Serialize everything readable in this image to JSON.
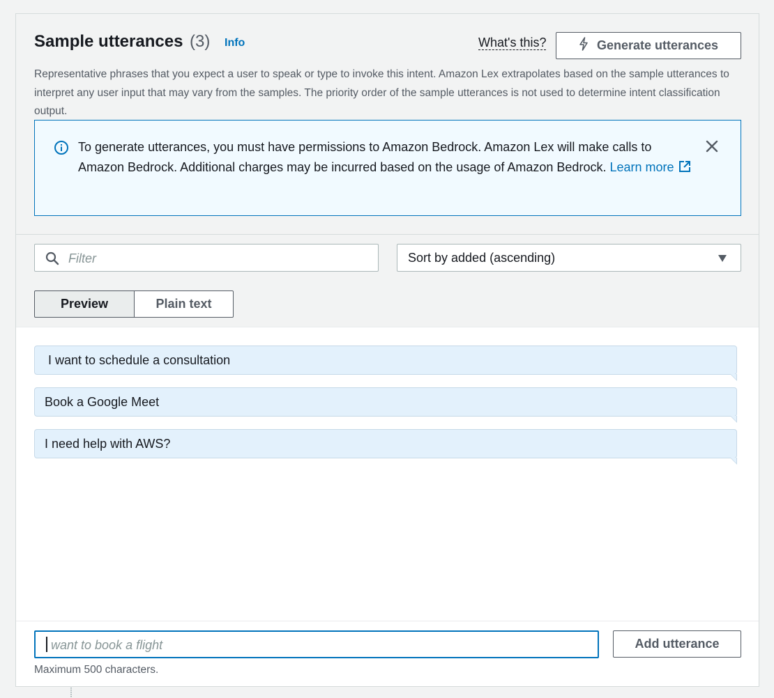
{
  "header": {
    "title": "Sample utterances",
    "count": "(3)",
    "info_label": "Info",
    "whats_this_label": "What's this?",
    "generate_button_label": "Generate utterances",
    "generate_icon": "lightning-icon"
  },
  "description": "Representative phrases that you expect a user to speak or type to invoke this intent. Amazon Lex extrapolates based on the sample utterances to interpret any user input that may vary from the samples. The priority order of the sample utterances is not used to determine intent classification output.",
  "alert": {
    "text": "To generate utterances, you must have permissions to Amazon Bedrock. Amazon Lex will make calls to Amazon Bedrock. Additional charges may be incurred based on the usage of Amazon Bedrock.",
    "link_label": "Learn more",
    "icon": "info-icon",
    "close_icon": "close-icon",
    "accent_color": "#0073bb"
  },
  "filter": {
    "placeholder": "Filter",
    "icon": "search-icon"
  },
  "sort": {
    "selected": "Sort by added (ascending)",
    "icon": "caret-down-icon"
  },
  "view_toggle": {
    "preview_label": "Preview",
    "plain_text_label": "Plain text",
    "selected": "Preview"
  },
  "utterances": [
    {
      "text": "I want to schedule a consultation"
    },
    {
      "text": "Book a Google Meet"
    },
    {
      "text": "I need help with AWS?"
    }
  ],
  "new_utterance": {
    "placeholder": "want to book a flight",
    "add_button_label": "Add utterance",
    "hint": "Maximum 500 characters."
  },
  "colors": {
    "link": "#0073bb",
    "utterance_bubble": "#e3f1fc",
    "alert_background": "#f1faff"
  }
}
